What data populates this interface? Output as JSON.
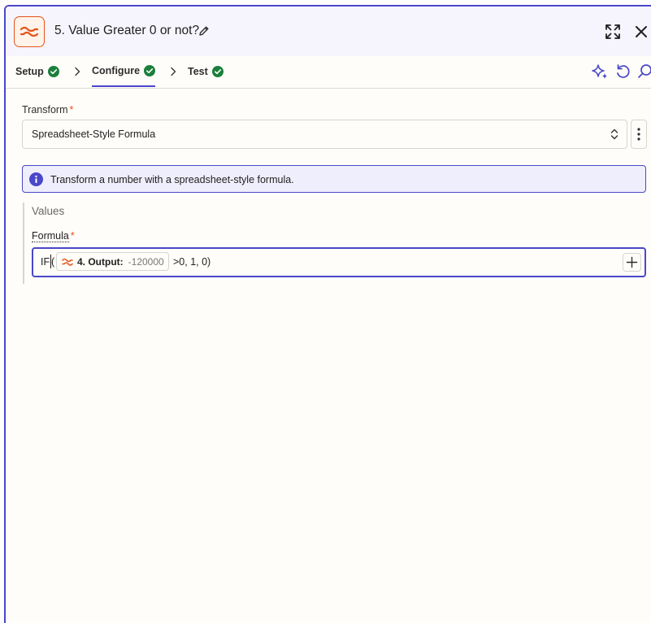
{
  "header": {
    "title": "5. Value Greater 0 or not?",
    "app_icon": "formatter-icon",
    "accent_color": "#e5531a"
  },
  "tabs": [
    {
      "label": "Setup",
      "complete": true
    },
    {
      "label": "Configure",
      "complete": true,
      "active": true
    },
    {
      "label": "Test",
      "complete": true
    }
  ],
  "toolbar": {
    "icons": [
      "ai-sparkle-icon",
      "refresh-icon",
      "search-icon"
    ],
    "accent_color": "#4a47c9"
  },
  "transform": {
    "label": "Transform",
    "required_mark": "*",
    "value": "Spreadsheet-Style Formula"
  },
  "info": {
    "text": "Transform a number with a spreadsheet-style formula."
  },
  "values": {
    "title": "Values",
    "formula": {
      "label": "Formula",
      "required_mark": "*",
      "prefix": "IF",
      "paren": "(",
      "pill_label": "4. Output:",
      "pill_value": "-120000",
      "suffix": ">0, 1, 0)"
    }
  }
}
